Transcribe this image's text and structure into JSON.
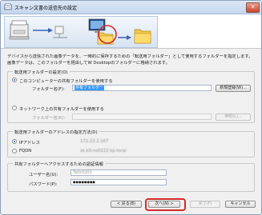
{
  "window": {
    "title": "スキャン文書の送信先の設定",
    "close_glyph": "✕"
  },
  "description": {
    "line1": "デバイスから送信された画像データを、一時的に保存するための「転送用フォルダー」として使用するフォルダーを指定します。",
    "line2": "画像データは、このフォルダーを経由してW Desktopのフォルダーに格納されます。"
  },
  "transfer_folder": {
    "group_label": "転送用フォルダーの設定(O)",
    "option_local": "このコンピューターの共有フォルダーを使用する",
    "folder_name_label": "フォルダー名(F):",
    "folder_name_value": "共有フォルダー",
    "new_folder_button": "新規登録(W)...",
    "option_network": "ネットワーク上の共有フォルダーを使用する",
    "network_folder_label": "フォルダー名(K):",
    "browse_button": "参照(L)..."
  },
  "address_spec": {
    "group_label": "転送用フォルダーのアドレスの指定方法(D)",
    "option_ip": "IPアドレス",
    "ip_value": "172.23.2.167",
    "option_fqdn": "FQDN",
    "fqdn_value": "sk.k0-ns0222.kp.local"
  },
  "auth": {
    "group_label": "共有フォルダーへアクセスするための認証情報",
    "username_label": "ユーザー名(U):",
    "username_value": "TeDr0201",
    "password_label": "パスワード(P):",
    "password_value": "●●●●●●●●"
  },
  "footer": {
    "back_button": "< 戻る(B)",
    "next_button": "次へ(N) >",
    "finish_button": "完了(F)",
    "cancel_button": "キャンセル"
  },
  "colors": {
    "highlight_ring": "#d42a2a",
    "selection": "#3399ff"
  }
}
